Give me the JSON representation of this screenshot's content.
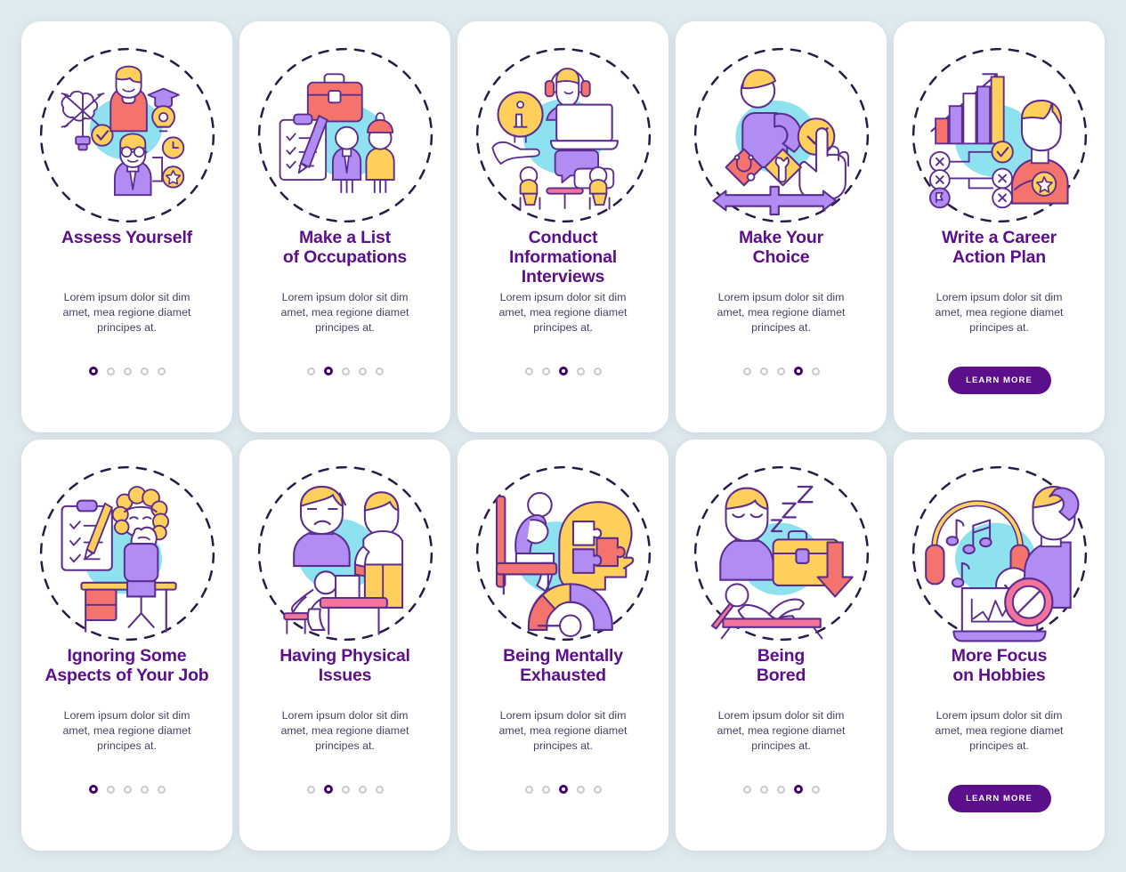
{
  "theme": {
    "background_color": "#dfeaee",
    "card_color": "#ffffff",
    "title_color": "#5c0f8b",
    "body_color": "#4a3f63",
    "accent_purple": "#3d0273",
    "button_color": "#5c0f8b",
    "blob_cyan": "#8ee2f0",
    "coral": "#f4736d",
    "yellow": "#ffcf5c",
    "lavender": "#b18cf2",
    "pink": "#f4739b",
    "outline": "#5b2d8e",
    "dot_inactive": "#c9c9d3"
  },
  "body_text": "Lorem ipsum dolor sit dim\namet, mea regione diamet\nprincipes at.",
  "learn_more_label": "LEARN MORE",
  "dots_count": 5,
  "cards": [
    {
      "id": "assess-yourself",
      "title": "Assess Yourself",
      "illustration": "assess-yourself-illustration",
      "body": "Lorem ipsum dolor sit dim\namet, mea regione diamet\nprincipes at.",
      "footer_type": "dots",
      "active_dot": 1
    },
    {
      "id": "make-a-list-of-occupations",
      "title": "Make a List\nof Occupations",
      "illustration": "occupations-list-illustration",
      "body": "Lorem ipsum dolor sit dim\namet, mea regione diamet\nprincipes at.",
      "footer_type": "dots",
      "active_dot": 2
    },
    {
      "id": "conduct-informational-interviews",
      "title": "Conduct\nInformational\nInterviews",
      "illustration": "informational-interviews-illustration",
      "body": "Lorem ipsum dolor sit dim\namet, mea regione diamet\nprincipes at.",
      "footer_type": "dots",
      "active_dot": 3
    },
    {
      "id": "make-your-choice",
      "title": "Make Your\nChoice",
      "illustration": "make-your-choice-illustration",
      "body": "Lorem ipsum dolor sit dim\namet, mea regione diamet\nprincipes at.",
      "footer_type": "dots",
      "active_dot": 4
    },
    {
      "id": "write-a-career-action-plan",
      "title": "Write a Career\nAction Plan",
      "illustration": "career-action-plan-illustration",
      "body": "Lorem ipsum dolor sit dim\namet, mea regione diamet\nprincipes at.",
      "footer_type": "button",
      "button_label": "LEARN MORE"
    },
    {
      "id": "ignoring-some-aspects-of-your-job",
      "title": "Ignoring Some\nAspects of Your Job",
      "illustration": "ignoring-job-aspects-illustration",
      "body": "Lorem ipsum dolor sit dim\namet, mea regione diamet\nprincipes at.",
      "footer_type": "dots",
      "active_dot": 1
    },
    {
      "id": "having-physical-issues",
      "title": "Having Physical\nIssues",
      "illustration": "physical-issues-illustration",
      "body": "Lorem ipsum dolor sit dim\namet, mea regione diamet\nprincipes at.",
      "footer_type": "dots",
      "active_dot": 2
    },
    {
      "id": "being-mentally-exhausted",
      "title": "Being Mentally\nExhausted",
      "illustration": "mentally-exhausted-illustration",
      "body": "Lorem ipsum dolor sit dim\namet, mea regione diamet\nprincipes at.",
      "footer_type": "dots",
      "active_dot": 3
    },
    {
      "id": "being-bored",
      "title": "Being\nBored",
      "illustration": "being-bored-illustration",
      "body": "Lorem ipsum dolor sit dim\namet, mea regione diamet\nprincipes at.",
      "footer_type": "dots",
      "active_dot": 4
    },
    {
      "id": "more-focus-on-hobbies",
      "title": "More Focus\non Hobbies",
      "illustration": "more-focus-hobbies-illustration",
      "body": "Lorem ipsum dolor sit dim\namet, mea regione diamet\nprincipes at.",
      "footer_type": "button",
      "button_label": "LEARN MORE"
    }
  ]
}
